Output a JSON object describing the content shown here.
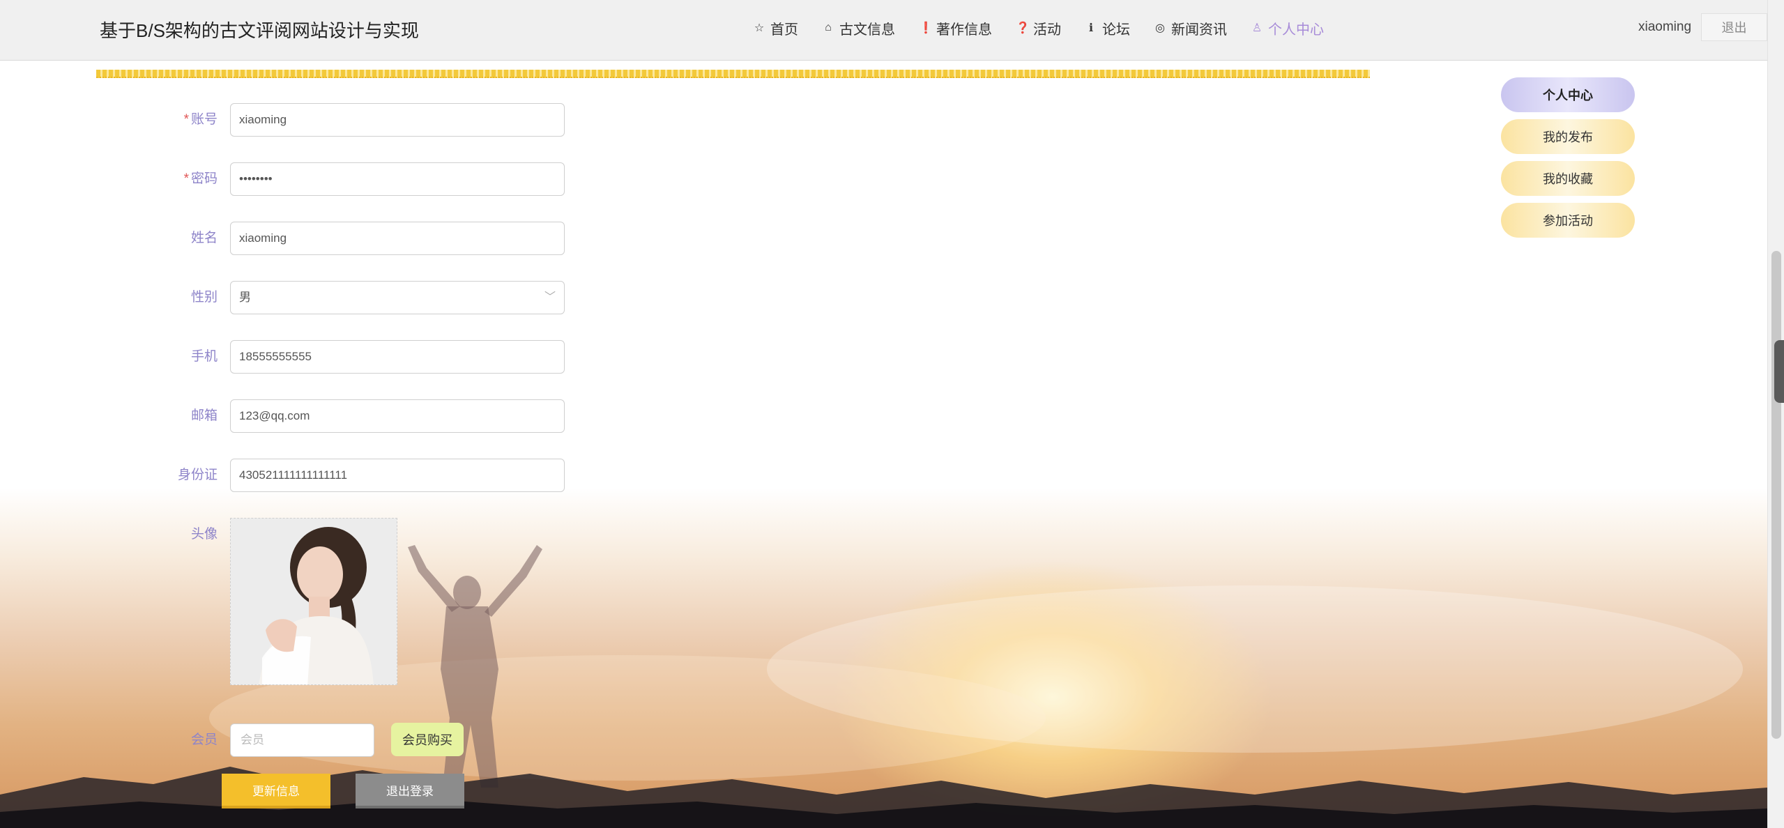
{
  "header": {
    "title": "基于B/S架构的古文评阅网站设计与实现",
    "nav": [
      {
        "icon": "☆",
        "icon_name": "star-icon",
        "label": "首页"
      },
      {
        "icon": "⌂",
        "icon_name": "home-icon",
        "label": "古文信息"
      },
      {
        "icon": "❗",
        "icon_name": "info-circle-icon",
        "label": "著作信息"
      },
      {
        "icon": "❓",
        "icon_name": "question-circle-icon",
        "label": "活动"
      },
      {
        "icon": "ℹ",
        "icon_name": "info-icon",
        "label": "论坛"
      },
      {
        "icon": "◎",
        "icon_name": "target-icon",
        "label": "新闻资讯"
      },
      {
        "icon": "♙",
        "icon_name": "user-icon",
        "label": "个人中心"
      }
    ],
    "username": "xiaoming",
    "logout": "退出"
  },
  "form": {
    "account_label": "账号",
    "account_value": "xiaoming",
    "password_label": "密码",
    "password_value": "••••••••",
    "name_label": "姓名",
    "name_value": "xiaoming",
    "gender_label": "性别",
    "gender_value": "男",
    "phone_label": "手机",
    "phone_value": "18555555555",
    "email_label": "邮箱",
    "email_value": "123@qq.com",
    "idcard_label": "身份证",
    "idcard_value": "430521111111111111",
    "avatar_label": "头像",
    "member_label": "会员",
    "member_placeholder": "会员",
    "member_buy": "会员购买",
    "update_button": "更新信息",
    "logout_button": "退出登录",
    "required_mark": "*"
  },
  "sidebar": {
    "items": [
      {
        "label": "个人中心",
        "active": true
      },
      {
        "label": "我的发布",
        "active": false
      },
      {
        "label": "我的收藏",
        "active": false
      },
      {
        "label": "参加活动",
        "active": false
      }
    ]
  },
  "colors": {
    "accent_purple": "#a78bd8",
    "label_purple": "#8e84c9",
    "yellow": "#f4bf2b",
    "gray_button": "#8c8c8c",
    "member_buy_bg": "#e6f3a0"
  }
}
